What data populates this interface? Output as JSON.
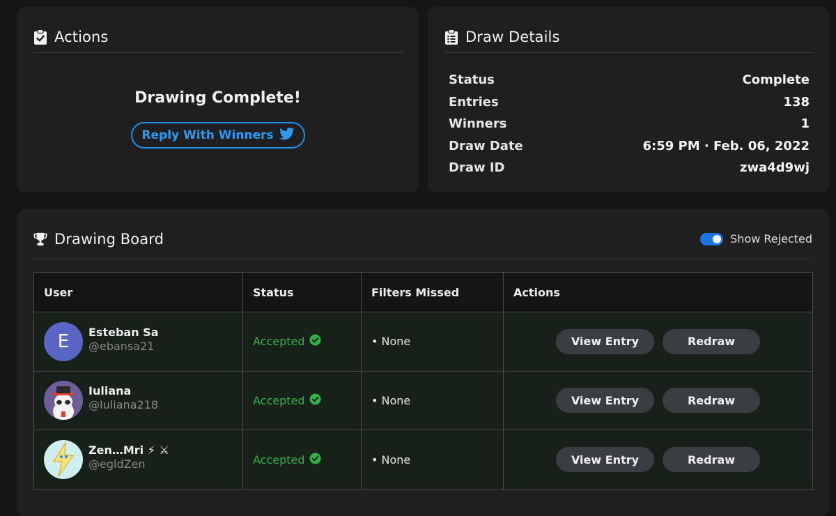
{
  "actions": {
    "title": "Actions",
    "complete_text": "Drawing Complete!",
    "reply_label": "Reply With Winners"
  },
  "details": {
    "title": "Draw Details",
    "rows": [
      {
        "label": "Status",
        "value": "Complete"
      },
      {
        "label": "Entries",
        "value": "138"
      },
      {
        "label": "Winners",
        "value": "1"
      },
      {
        "label": "Draw Date",
        "value": "6:59 PM · Feb. 06, 2022"
      },
      {
        "label": "Draw ID",
        "value": "zwa4d9wj"
      }
    ]
  },
  "board": {
    "title": "Drawing Board",
    "toggle_label": "Show Rejected",
    "toggle_on": true,
    "columns": [
      "User",
      "Status",
      "Filters Missed",
      "Actions"
    ],
    "rows": [
      {
        "name": "Esteban Sa",
        "handle": "@ebansa21",
        "avatar_letter": "E",
        "status": "Accepted",
        "filters": "• None",
        "view_label": "View Entry",
        "redraw_label": "Redraw"
      },
      {
        "name": "Iuliana",
        "handle": "@Iuliana218",
        "avatar_letter": "",
        "status": "Accepted",
        "filters": "• None",
        "view_label": "View Entry",
        "redraw_label": "Redraw"
      },
      {
        "name": "Zen…Mri ⚡ ⚔",
        "handle": "@egldZen",
        "avatar_letter": "",
        "status": "Accepted",
        "filters": "• None",
        "view_label": "View Entry",
        "redraw_label": "Redraw"
      }
    ]
  },
  "colors": {
    "accent_blue": "#1f8fe8",
    "accepted_green": "#2fb344",
    "row_background": "#17211a",
    "card_background": "#1f1f21"
  },
  "icons": {
    "actions": "clipboard-check-icon",
    "details": "clipboard-list-icon",
    "board": "trophy-icon",
    "reply": "twitter-bird-icon",
    "status": "check-circle-icon"
  }
}
